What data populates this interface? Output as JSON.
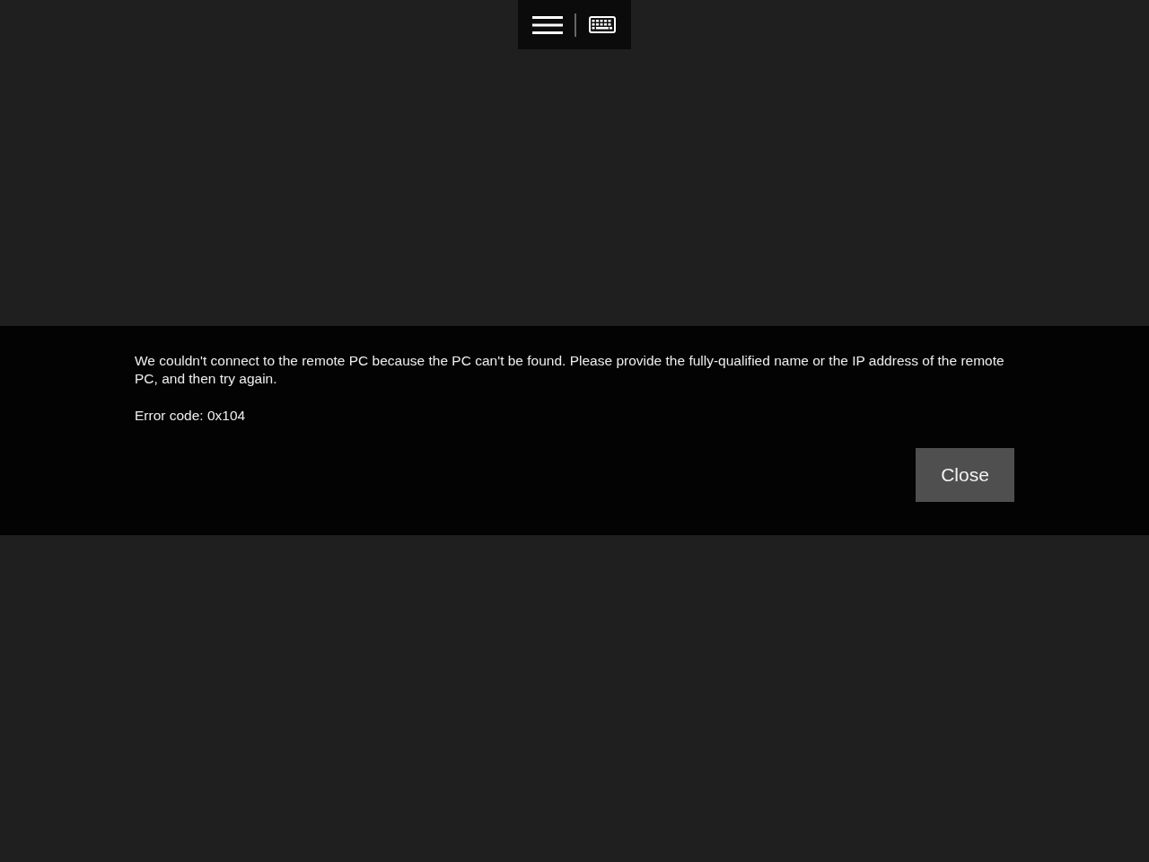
{
  "toolbar": {
    "buttons": [
      {
        "kind": "menu"
      },
      {
        "kind": "keyboard"
      }
    ]
  },
  "dialog": {
    "message": "We couldn't connect to the remote PC because the PC can't be found. Please provide the fully-qualified name or the IP address of the remote PC, and then try again.",
    "error_code": "Error code: 0x104",
    "buttons": [
      "Close"
    ]
  }
}
